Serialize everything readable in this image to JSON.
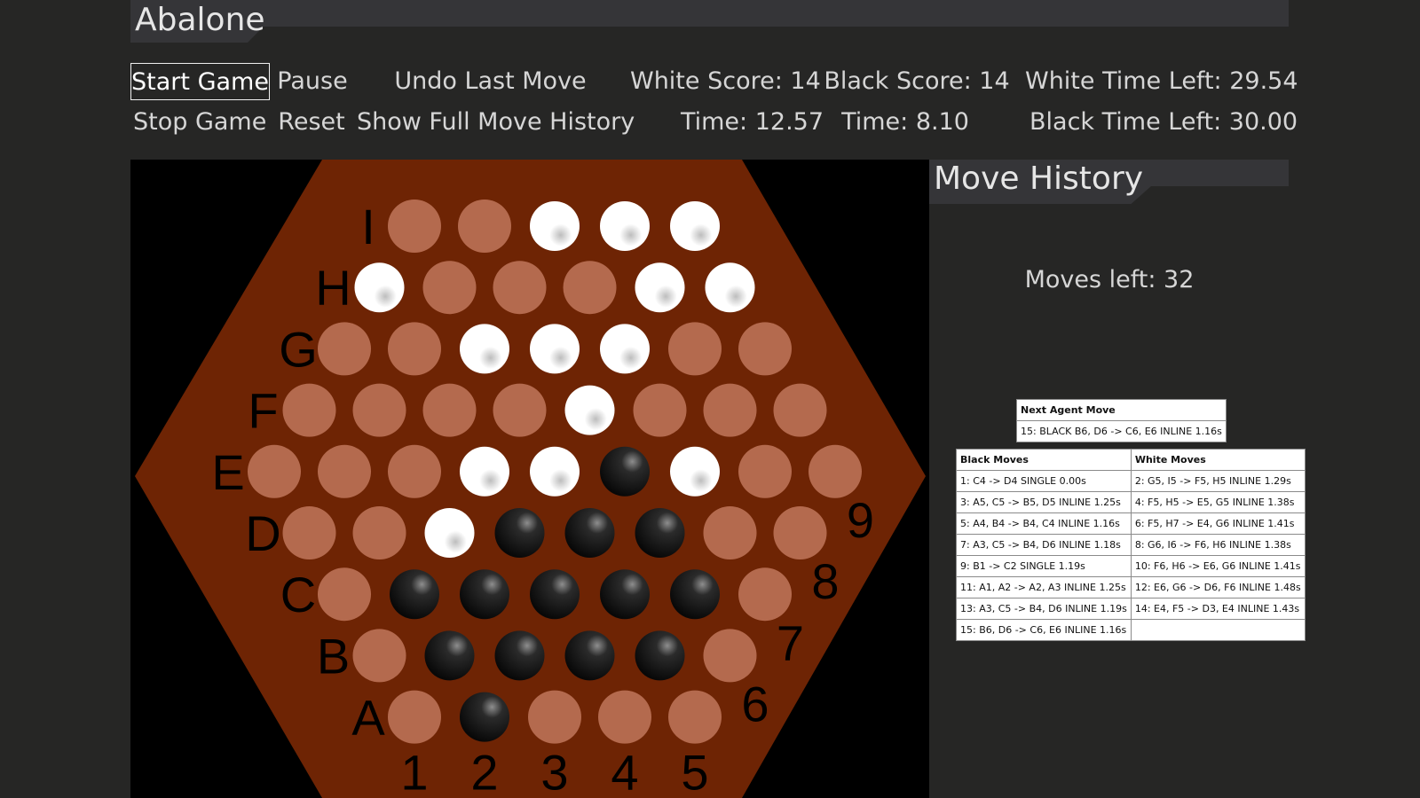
{
  "app": {
    "title": "Abalone"
  },
  "controls": {
    "start": "Start Game",
    "pause": "Pause",
    "undo": "Undo Last Move",
    "stop": "Stop Game",
    "reset": "Reset",
    "history": "Show Full Move History"
  },
  "stats": {
    "white_score": "White Score: 14",
    "black_score": "Black Score:  14",
    "white_time_left": "White Time Left: 29.54",
    "white_time": "Time: 12.57",
    "black_time": "Time: 8.10",
    "black_time_left": "Black Time Left: 30.00"
  },
  "board": {
    "colors": {
      "hexagon": "#6e2404",
      "empty": "#b46a4e",
      "white": "#ffffff",
      "black": "#111111",
      "background": "#000000"
    },
    "row_labels": [
      "I",
      "H",
      "G",
      "F",
      "E",
      "D",
      "C",
      "B",
      "A"
    ],
    "col_labels": [
      "1",
      "2",
      "3",
      "4",
      "5",
      "6",
      "7",
      "8",
      "9"
    ],
    "rows": [
      [
        "e",
        "e",
        "w",
        "w",
        "w"
      ],
      [
        "w",
        "e",
        "e",
        "e",
        "w",
        "w"
      ],
      [
        "e",
        "e",
        "w",
        "w",
        "w",
        "e",
        "e"
      ],
      [
        "e",
        "e",
        "e",
        "e",
        "w",
        "e",
        "e",
        "e"
      ],
      [
        "e",
        "e",
        "e",
        "w",
        "w",
        "b",
        "w",
        "e",
        "e"
      ],
      [
        "e",
        "e",
        "w",
        "b",
        "b",
        "b",
        "e",
        "e"
      ],
      [
        "e",
        "b",
        "b",
        "b",
        "b",
        "b",
        "e"
      ],
      [
        "e",
        "b",
        "b",
        "b",
        "b",
        "e"
      ],
      [
        "e",
        "b",
        "e",
        "e",
        "e"
      ]
    ]
  },
  "panel": {
    "title": "Move History",
    "moves_left": "Moves left: 32",
    "next_move_header": "Next Agent Move",
    "next_move": "15: BLACK B6, D6 -> C6, E6 INLINE 1.16s",
    "black_header": "Black Moves",
    "white_header": "White Moves",
    "rows": [
      [
        "1: C4 -> D4 SINGLE 0.00s",
        "2: G5, I5 -> F5, H5 INLINE 1.29s"
      ],
      [
        "3: A5, C5 -> B5, D5 INLINE 1.25s",
        "4: F5, H5 -> E5, G5 INLINE 1.38s"
      ],
      [
        "5: A4, B4 -> B4, C4 INLINE 1.16s",
        "6: F5, H7 -> E4, G6 INLINE 1.41s"
      ],
      [
        "7: A3, C5 -> B4, D6 INLINE 1.18s",
        "8: G6, I6 -> F6, H6 INLINE 1.38s"
      ],
      [
        "9: B1 -> C2 SINGLE 1.19s",
        "10: F6, H6 -> E6, G6 INLINE 1.41s"
      ],
      [
        "11: A1, A2 -> A2, A3 INLINE 1.25s",
        "12: E6, G6 -> D6, F6 INLINE 1.48s"
      ],
      [
        "13: A3, C5 -> B4, D6 INLINE 1.19s",
        "14: E4, F5 -> D3, E4 INLINE 1.43s"
      ],
      [
        "15: B6, D6 -> C6, E6 INLINE 1.16s",
        ""
      ]
    ]
  }
}
